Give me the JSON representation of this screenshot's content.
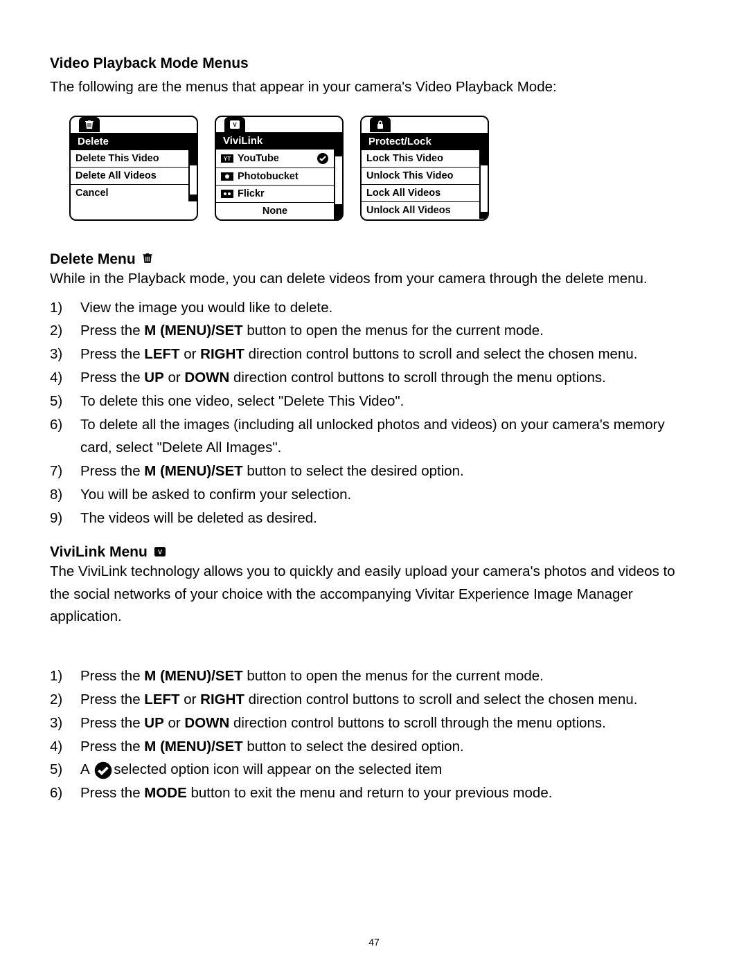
{
  "page_number": "47",
  "heading": "Video Playback Mode Menus",
  "intro": "The following are the menus that appear in your camera's Video Playback Mode:",
  "menus": {
    "delete": {
      "title": "Delete",
      "icon": "trash-icon",
      "items": [
        "Delete This Video",
        "Delete All Videos",
        "Cancel"
      ]
    },
    "vivilink": {
      "title": "ViviLink",
      "icon": "vivilink-icon",
      "items": [
        {
          "icon": "youtube-icon",
          "label": "YouTube",
          "selected": true
        },
        {
          "icon": "photobucket-icon",
          "label": "Photobucket"
        },
        {
          "icon": "flickr-icon",
          "label": "Flickr"
        },
        {
          "label": "None"
        }
      ]
    },
    "protect": {
      "title": "Protect/Lock",
      "icon": "lock-icon",
      "items": [
        "Lock This Video",
        "Unlock This Video",
        "Lock All Videos",
        "Unlock All Videos"
      ]
    }
  },
  "delete_section": {
    "title": "Delete Menu",
    "text": "While in the Playback mode, you can delete videos from your camera through the delete menu.",
    "steps": [
      [
        {
          "t": "View the image you would like to delete."
        }
      ],
      [
        {
          "t": "Press the "
        },
        {
          "b": "M (MENU)/SET"
        },
        {
          "t": " button to open the menus for the current mode."
        }
      ],
      [
        {
          "t": "Press the "
        },
        {
          "b": "LEFT"
        },
        {
          "t": " or "
        },
        {
          "b": "RIGHT"
        },
        {
          "t": " direction control buttons to scroll and select the chosen menu."
        }
      ],
      [
        {
          "t": "Press the "
        },
        {
          "b": "UP"
        },
        {
          "t": " or "
        },
        {
          "b": "DOWN"
        },
        {
          "t": " direction control buttons to scroll through the menu options."
        }
      ],
      [
        {
          "t": "To delete this one video, select \"Delete This Video\"."
        }
      ],
      [
        {
          "t": "To delete all the images (including all unlocked photos and videos) on your camera's memory card, select \"Delete All Images\"."
        }
      ],
      [
        {
          "t": "Press the "
        },
        {
          "b": "M (MENU)/SET"
        },
        {
          "t": " button to select the desired option."
        }
      ],
      [
        {
          "t": "You will be asked to confirm your selection."
        }
      ],
      [
        {
          "t": "The videos will be deleted as desired."
        }
      ]
    ]
  },
  "vivilink_section": {
    "title": "ViviLink Menu",
    "text": "The ViviLink technology allows you to quickly and easily upload your camera's photos and videos to the social networks of your choice with the accompanying Vivitar Experience Image Manager application.",
    "steps": [
      [
        {
          "t": "Press the "
        },
        {
          "b": "M (MENU)/SET"
        },
        {
          "t": " button to open the menus for the current mode."
        }
      ],
      [
        {
          "t": "Press the "
        },
        {
          "b": "LEFT"
        },
        {
          "t": " or "
        },
        {
          "b": "RIGHT"
        },
        {
          "t": " direction control buttons to scroll and select the chosen menu."
        }
      ],
      [
        {
          "t": "Press the "
        },
        {
          "b": "UP"
        },
        {
          "t": " or "
        },
        {
          "b": "DOWN"
        },
        {
          "t": " direction control buttons to scroll through the menu options."
        }
      ],
      [
        {
          "t": "Press the "
        },
        {
          "b": "M (MENU)/SET"
        },
        {
          "t": " button to select the desired option."
        }
      ],
      [
        {
          "t": "A "
        },
        {
          "icon": "check-circle"
        },
        {
          "t": "selected option icon will appear on the selected item"
        }
      ],
      [
        {
          "t": "Press the "
        },
        {
          "b": "MODE"
        },
        {
          "t": " button to exit the menu and return to your previous mode."
        }
      ]
    ]
  }
}
